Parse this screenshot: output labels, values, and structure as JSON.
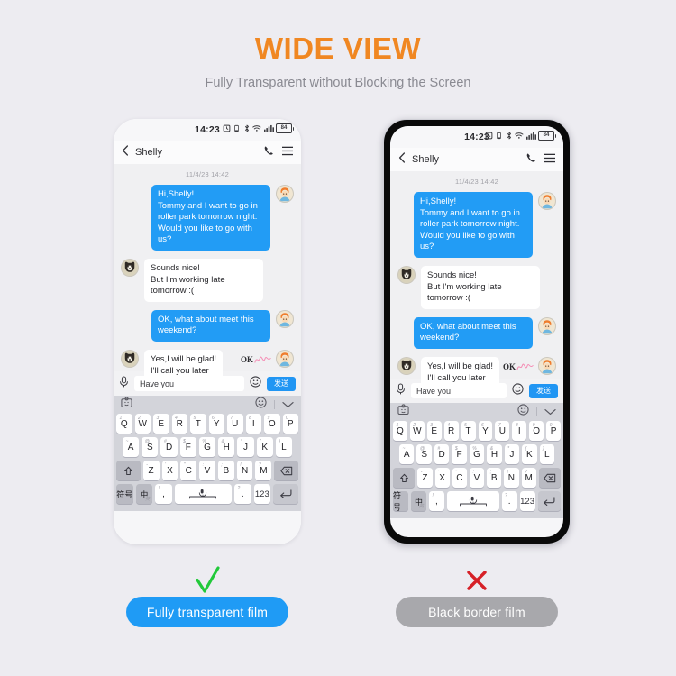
{
  "header": {
    "title": "WIDE VIEW",
    "subtitle": "Fully Transparent without Blocking the Screen",
    "title_color": "#f08722",
    "subtitle_color": "#8a8a92"
  },
  "background_color": "#edecf1",
  "phone": {
    "status_bar": {
      "time": "14:23",
      "battery_level": "84",
      "icons": [
        "alarm-icon",
        "vibrate-icon",
        "bluetooth-icon",
        "wifi-icon",
        "signal-icon",
        "battery-icon"
      ]
    },
    "nav": {
      "back_icon": "chevron-left-icon",
      "contact_name": "Shelly",
      "call_icon": "phone-icon",
      "menu_icon": "hamburger-menu-icon"
    },
    "conversation": {
      "datestamp": "11/4/23 14:42",
      "messages": [
        {
          "side": "out",
          "text": "Hi,Shelly!\nTommy and I want to go in roller park tomorrow night. Would you like to go with us?"
        },
        {
          "side": "in",
          "text": "Sounds nice!\nBut I'm working late tomorrow :("
        },
        {
          "side": "out",
          "text": "OK, what about meet this weekend?"
        },
        {
          "side": "in",
          "text": "Yes,I will be glad!\nI'll call you later"
        }
      ],
      "sticker_label": "OK",
      "bubble_out_color": "#229cf5",
      "bubble_in_color": "#ffffff"
    },
    "input_bar": {
      "mic_icon": "microphone-icon",
      "text_value": "Have you",
      "emoji_icon": "emoji-smiley-icon",
      "send_label": "发送",
      "send_color": "#2196f3"
    },
    "keyboard": {
      "toolbar": {
        "sticker_icon": "sticker-avatar-icon",
        "emoji_icon": "emoji-smiley-icon",
        "collapse_icon": "chevron-down-icon"
      },
      "row1": [
        {
          "label": "Q",
          "sup": "1"
        },
        {
          "label": "W",
          "sup": "2"
        },
        {
          "label": "E",
          "sup": "3"
        },
        {
          "label": "R",
          "sup": "4"
        },
        {
          "label": "T",
          "sup": "5"
        },
        {
          "label": "Y",
          "sup": "6"
        },
        {
          "label": "U",
          "sup": "7"
        },
        {
          "label": "I",
          "sup": "8"
        },
        {
          "label": "O",
          "sup": "9"
        },
        {
          "label": "P",
          "sup": "0"
        }
      ],
      "row2": [
        {
          "label": "A",
          "sup": "~"
        },
        {
          "label": "S",
          "sup": "@"
        },
        {
          "label": "D",
          "sup": "#"
        },
        {
          "label": "F",
          "sup": "$"
        },
        {
          "label": "G",
          "sup": "%"
        },
        {
          "label": "H",
          "sup": "&"
        },
        {
          "label": "J",
          "sup": "*"
        },
        {
          "label": "K",
          "sup": "("
        },
        {
          "label": "L",
          "sup": ")"
        }
      ],
      "row3": {
        "shift_icon": "shift-arrow-icon",
        "keys": [
          {
            "label": "Z",
            "sup": "-"
          },
          {
            "label": "X",
            "sup": "'"
          },
          {
            "label": "C",
            "sup": "\""
          },
          {
            "label": "V",
            "sup": ":"
          },
          {
            "label": "B",
            "sup": ";"
          },
          {
            "label": "N",
            "sup": "!"
          },
          {
            "label": "M",
            "sup": "?"
          }
        ],
        "backspace_icon": "backspace-icon"
      },
      "row4": {
        "symbol_label": "符号",
        "lang_label": "中",
        "lang_sub": "英",
        "comma_sup": "!",
        "comma_label": ",",
        "space_icon": "microphone-icon",
        "period_sup": "?",
        "period_label": ".",
        "number_label": "123",
        "enter_icon": "enter-return-icon"
      }
    }
  },
  "verdicts": {
    "left": {
      "mark": "check-mark",
      "mark_color": "#22c93a",
      "label": "Fully transparent film",
      "pill_color": "#1f9bf5"
    },
    "right": {
      "mark": "cross-mark",
      "mark_color": "#d62027",
      "label": "Black border film",
      "pill_color": "#a8a8ac"
    }
  }
}
